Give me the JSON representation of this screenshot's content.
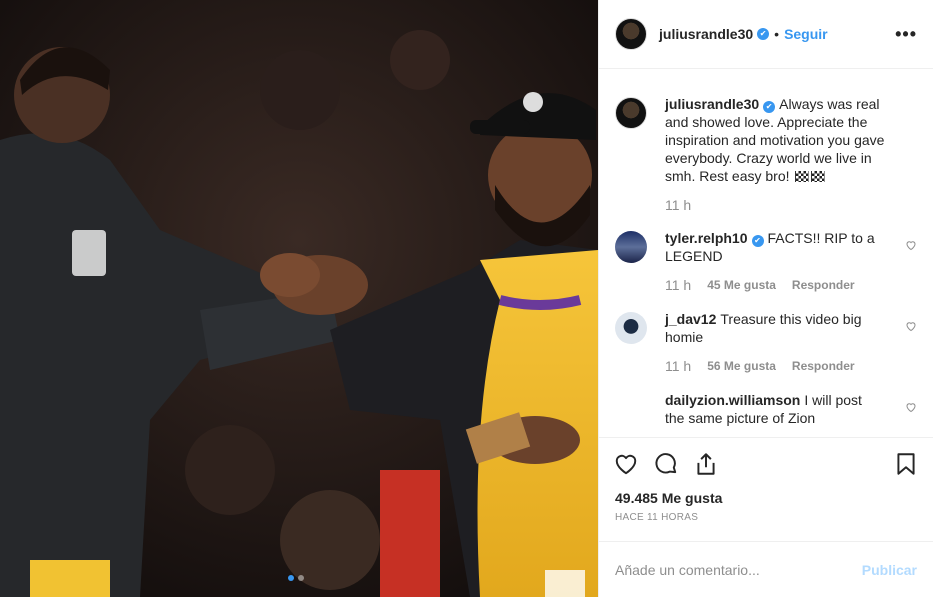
{
  "post": {
    "author": "juliusrandle30",
    "follow_label": "Seguir",
    "separator": "•",
    "more_label": "•••",
    "verified_mark": "✔",
    "carousel": {
      "count": 2,
      "active": 1
    }
  },
  "caption": {
    "username": "juliusrandle30",
    "text": "Always was real and showed love. Appreciate the inspiration and motivation you gave everybody. Crazy world we live in smh. Rest easy bro!",
    "emoji": "chequered-flag-emoji",
    "time": "11 h"
  },
  "comments": [
    {
      "username": "tyler.relph10",
      "text": "FACTS!! RIP to a LEGEND",
      "time": "11 h",
      "likes": "45 Me gusta",
      "reply": "Responder",
      "verified": true
    },
    {
      "username": "j_dav12",
      "text": "Treasure this video big homie",
      "time": "11 h",
      "likes": "56 Me gusta",
      "reply": "Responder",
      "verified": false
    },
    {
      "username": "dailyzion.williamson",
      "text": "I will post the same picture of Zion",
      "verified": false
    }
  ],
  "footer": {
    "likes": "49.485 Me gusta",
    "time_ago": "HACE 11 HORAS",
    "comment_placeholder": "Añade un comentario...",
    "post_label": "Publicar"
  },
  "icons": [
    "heart-icon",
    "comment-icon",
    "share-icon",
    "bookmark-icon",
    "more-icon",
    "verified-icon"
  ],
  "colors": {
    "accent": "#3897f0",
    "muted": "#8e8e8e",
    "text": "#262626",
    "post_disabled": "#b3dbff"
  }
}
